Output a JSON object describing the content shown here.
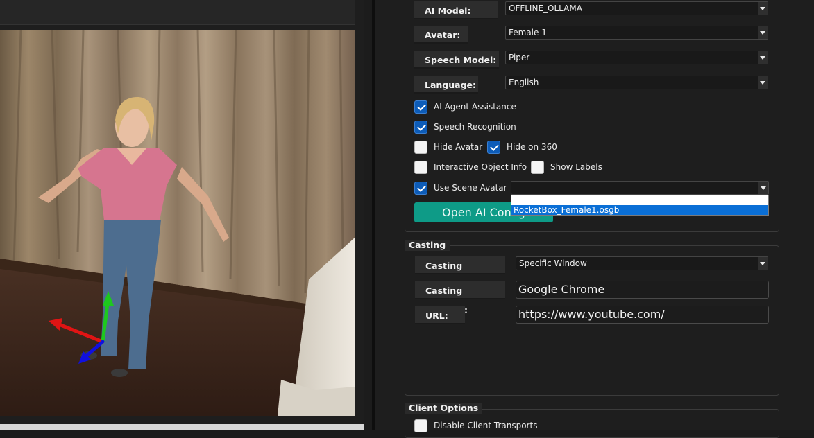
{
  "ai_config": {
    "ai_model": {
      "label": "AI Model:",
      "value": "OFFLINE_OLLAMA"
    },
    "avatar": {
      "label": "Avatar:",
      "value": "Female 1"
    },
    "speech_model": {
      "label": "Speech Model:",
      "value": "Piper"
    },
    "language": {
      "label": "Language:",
      "value": "English"
    },
    "checkboxes": {
      "ai_agent_assistance": {
        "label": "AI Agent Assistance",
        "checked": true
      },
      "speech_recognition": {
        "label": "Speech Recognition",
        "checked": true
      },
      "hide_avatar": {
        "label": "Hide Avatar",
        "checked": false
      },
      "hide_on_360": {
        "label": "Hide on 360",
        "checked": true
      },
      "interactive_object_info": {
        "label": "Interactive Object Info",
        "checked": false
      },
      "show_labels": {
        "label": "Show Labels",
        "checked": false
      },
      "use_scene_avatar": {
        "label": "Use Scene Avatar",
        "checked": true
      }
    },
    "scene_avatar_combo_value": "",
    "scene_avatar_options": [
      "RocketBox_Female1.osgb"
    ],
    "open_button_label": "Open AI Config"
  },
  "casting": {
    "title": "Casting",
    "method": {
      "label": "Casting Method:",
      "value": "Specific Window"
    },
    "window": {
      "label": "Casting Window:",
      "value": "Google Chrome"
    },
    "url": {
      "label": "URL:",
      "value": "https://www.youtube.com/"
    }
  },
  "client_options": {
    "title": "Client Options",
    "disable_client_transports": {
      "label": "Disable Client Transports",
      "checked": false
    }
  },
  "colors": {
    "accent_teal": "#0e9b87",
    "check_blue": "#0d5cb8",
    "selection_blue": "#0a6fd6",
    "axis_x": "#e01414",
    "axis_y": "#1ec81e",
    "axis_z": "#1010e0"
  }
}
